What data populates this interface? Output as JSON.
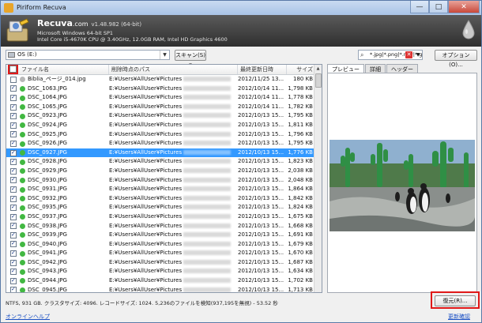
{
  "window": {
    "title": "Piriform Recuva",
    "minimize": "—",
    "maximize": "□",
    "close": "✕"
  },
  "header": {
    "brand": "Recuva",
    "brand_suffix": ".com",
    "version": "v1.48.982 (64-bit)",
    "os": "Microsoft Windows 64-bit SP1",
    "hardware": "Intel Core i5-4670K CPU @ 3.40GHz, 12.0GB RAM, Intel HD Graphics 4600"
  },
  "toolbar": {
    "drive": "OS (E:)",
    "scan_label": "スキャン(S)",
    "filter_value": "*.jpg|*.png|*.raw|*.gif",
    "options_label": "オプション(O)..."
  },
  "table": {
    "columns": {
      "name": "ファイル名",
      "path": "削除時点のパス",
      "date": "最終更新日時",
      "size": "サイズ"
    },
    "rows": [
      {
        "checked": false,
        "state": "gray",
        "name": "Biblia_ページ_014.jpg",
        "path": "E:¥Users¥AllUser¥Pictures",
        "date": "2012/11/25 13...",
        "size": "180 KB",
        "selected": false
      },
      {
        "checked": true,
        "state": "green",
        "name": "DSC_1063.JPG",
        "path": "E:¥Users¥AllUser¥Pictures",
        "date": "2012/10/14 11...",
        "size": "1,798 KB",
        "selected": false
      },
      {
        "checked": true,
        "state": "green",
        "name": "DSC_1064.JPG",
        "path": "E:¥Users¥AllUser¥Pictures",
        "date": "2012/10/14 11...",
        "size": "1,778 KB",
        "selected": false
      },
      {
        "checked": true,
        "state": "green",
        "name": "DSC_1065.JPG",
        "path": "E:¥Users¥AllUser¥Pictures",
        "date": "2012/10/14 11...",
        "size": "1,782 KB",
        "selected": false
      },
      {
        "checked": true,
        "state": "green",
        "name": "DSC_0923.JPG",
        "path": "E:¥Users¥AllUser¥Pictures",
        "date": "2012/10/13 15...",
        "size": "1,795 KB",
        "selected": false
      },
      {
        "checked": true,
        "state": "green",
        "name": "DSC_0924.JPG",
        "path": "E:¥Users¥AllUser¥Pictures",
        "date": "2012/10/13 15...",
        "size": "1,811 KB",
        "selected": false
      },
      {
        "checked": true,
        "state": "green",
        "name": "DSC_0925.JPG",
        "path": "E:¥Users¥AllUser¥Pictures",
        "date": "2012/10/13 15...",
        "size": "1,796 KB",
        "selected": false
      },
      {
        "checked": true,
        "state": "green",
        "name": "DSC_0926.JPG",
        "path": "E:¥Users¥AllUser¥Pictures",
        "date": "2012/10/13 15...",
        "size": "1,795 KB",
        "selected": false
      },
      {
        "checked": true,
        "state": "green",
        "name": "DSC_0927.JPG",
        "path": "E:¥Users¥AllUser¥Pictures",
        "date": "2012/10/13 15...",
        "size": "1,776 KB",
        "selected": true
      },
      {
        "checked": true,
        "state": "green",
        "name": "DSC_0928.JPG",
        "path": "E:¥Users¥AllUser¥Pictures",
        "date": "2012/10/13 15...",
        "size": "1,823 KB",
        "selected": false
      },
      {
        "checked": true,
        "state": "green",
        "name": "DSC_0929.JPG",
        "path": "E:¥Users¥AllUser¥Pictures",
        "date": "2012/10/13 15...",
        "size": "2,038 KB",
        "selected": false
      },
      {
        "checked": true,
        "state": "green",
        "name": "DSC_0930.JPG",
        "path": "E:¥Users¥AllUser¥Pictures",
        "date": "2012/10/13 15...",
        "size": "2,048 KB",
        "selected": false
      },
      {
        "checked": true,
        "state": "green",
        "name": "DSC_0931.JPG",
        "path": "E:¥Users¥AllUser¥Pictures",
        "date": "2012/10/13 15...",
        "size": "1,864 KB",
        "selected": false
      },
      {
        "checked": true,
        "state": "green",
        "name": "DSC_0932.JPG",
        "path": "E:¥Users¥AllUser¥Pictures",
        "date": "2012/10/13 15...",
        "size": "1,842 KB",
        "selected": false
      },
      {
        "checked": true,
        "state": "green",
        "name": "DSC_0935.JPG",
        "path": "E:¥Users¥AllUser¥Pictures",
        "date": "2012/10/13 15...",
        "size": "1,824 KB",
        "selected": false
      },
      {
        "checked": true,
        "state": "green",
        "name": "DSC_0937.JPG",
        "path": "E:¥Users¥AllUser¥Pictures",
        "date": "2012/10/13 15...",
        "size": "1,675 KB",
        "selected": false
      },
      {
        "checked": true,
        "state": "green",
        "name": "DSC_0938.JPG",
        "path": "E:¥Users¥AllUser¥Pictures",
        "date": "2012/10/13 15...",
        "size": "1,668 KB",
        "selected": false
      },
      {
        "checked": true,
        "state": "green",
        "name": "DSC_0939.JPG",
        "path": "E:¥Users¥AllUser¥Pictures",
        "date": "2012/10/13 15...",
        "size": "1,691 KB",
        "selected": false
      },
      {
        "checked": true,
        "state": "green",
        "name": "DSC_0940.JPG",
        "path": "E:¥Users¥AllUser¥Pictures",
        "date": "2012/10/13 15...",
        "size": "1,679 KB",
        "selected": false
      },
      {
        "checked": true,
        "state": "green",
        "name": "DSC_0941.JPG",
        "path": "E:¥Users¥AllUser¥Pictures",
        "date": "2012/10/13 15...",
        "size": "1,670 KB",
        "selected": false
      },
      {
        "checked": true,
        "state": "green",
        "name": "DSC_0942.JPG",
        "path": "E:¥Users¥AllUser¥Pictures",
        "date": "2012/10/13 15...",
        "size": "1,687 KB",
        "selected": false
      },
      {
        "checked": true,
        "state": "green",
        "name": "DSC_0943.JPG",
        "path": "E:¥Users¥AllUser¥Pictures",
        "date": "2012/10/13 15...",
        "size": "1,634 KB",
        "selected": false
      },
      {
        "checked": true,
        "state": "green",
        "name": "DSC_0944.JPG",
        "path": "E:¥Users¥AllUser¥Pictures",
        "date": "2012/10/13 15...",
        "size": "1,702 KB",
        "selected": false
      },
      {
        "checked": true,
        "state": "green",
        "name": "DSC_0945.JPG",
        "path": "E:¥Users¥AllUser¥Pictures",
        "date": "2012/10/13 15...",
        "size": "1,713 KB",
        "selected": false
      }
    ]
  },
  "preview": {
    "tabs": [
      "プレビュー",
      "詳細",
      "ヘッダー"
    ],
    "active_tab": 0
  },
  "status": "NTFS, 931 GB. クラスタサイズ: 4096. レコードサイズ: 1024. 5,236のファイルを検知(937,195を無視) - 53.52 秒",
  "recover_label": "復元(R)...",
  "footer": {
    "help_link": "オンラインヘルプ",
    "update_link": "更新確認"
  },
  "colors": {
    "selection": "#3399ff",
    "recovered_state": "#42b842",
    "highlight_box": "#e01818",
    "link": "#1a4fc4"
  }
}
